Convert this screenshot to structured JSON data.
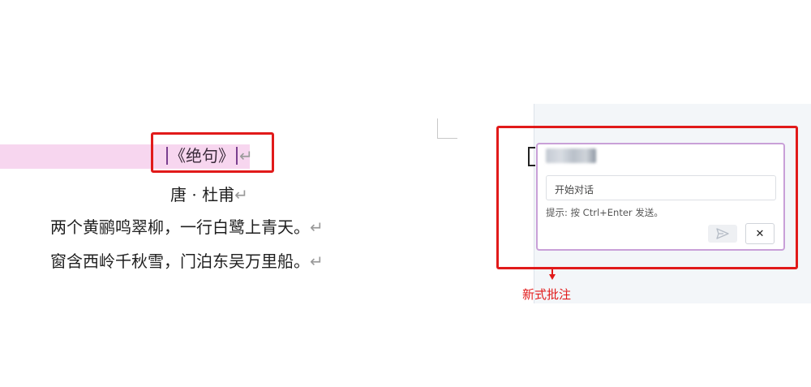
{
  "document": {
    "title": "《绝句》",
    "author": "唐 · 杜甫",
    "lines": [
      "两个黄鹂鸣翠柳，一行白鹭上青天。",
      "窗含西岭千秋雪，门泊东吴万里船。"
    ],
    "return_mark": "↵"
  },
  "comment": {
    "input_placeholder": "开始对话",
    "hint": "提示: 按 Ctrl+Enter 发送。",
    "send_icon": "send-icon",
    "close_label": "✕"
  },
  "annotation": {
    "label": "新式批注",
    "color": "#e11a1a"
  },
  "colors": {
    "highlight": "#f7d6ef",
    "card_border": "#c9a0d8",
    "pane_background": "#f3f6f9"
  }
}
